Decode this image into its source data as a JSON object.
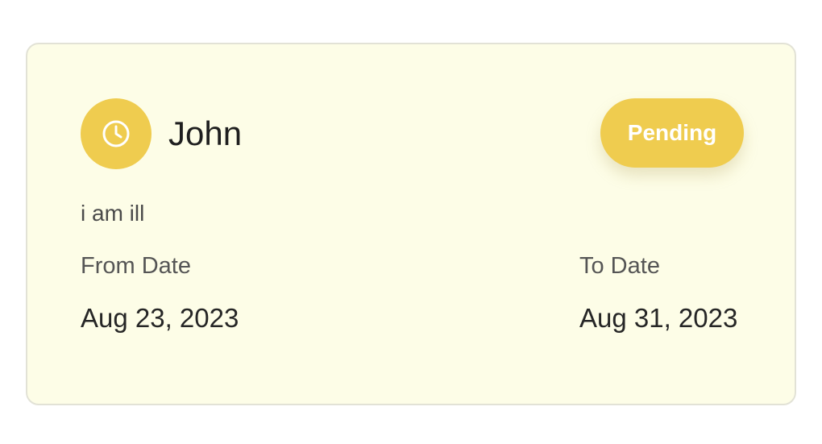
{
  "request": {
    "status_icon": "clock-icon",
    "name": "John",
    "status": "Pending",
    "reason": "i am ill",
    "from_label": "From Date",
    "from_value": "Aug 23, 2023",
    "to_label": "To Date",
    "to_value": "Aug 31, 2023"
  },
  "colors": {
    "card_background": "#fdfde7",
    "accent": "#efcc4f",
    "badge_text": "#ffffff"
  }
}
